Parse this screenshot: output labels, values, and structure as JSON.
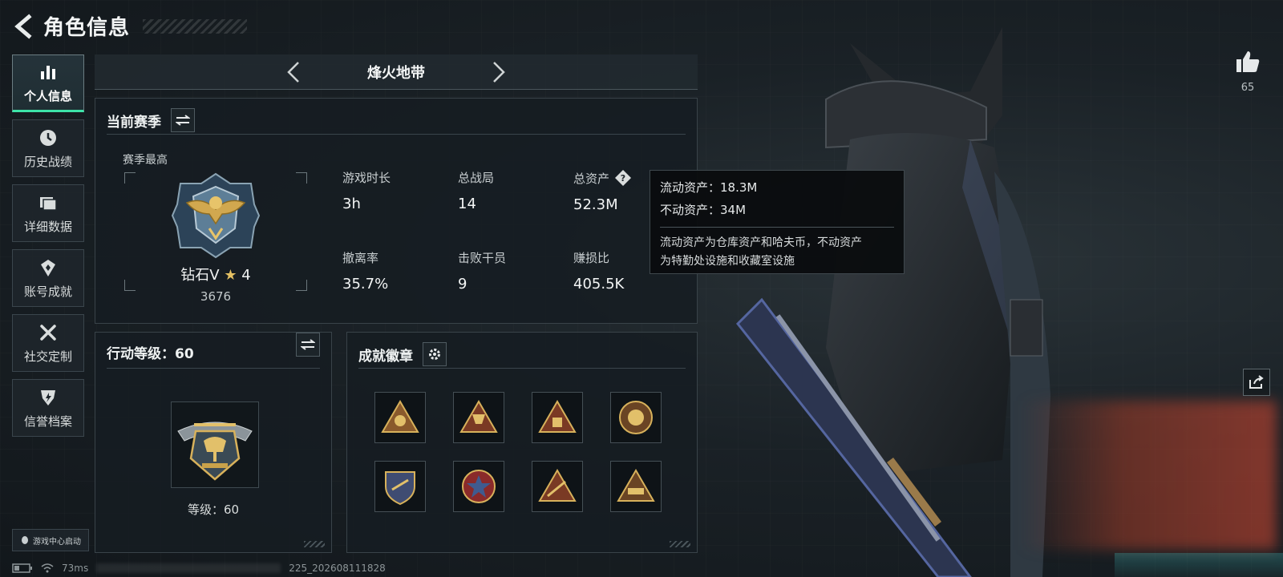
{
  "header": {
    "title": "角色信息"
  },
  "sidebar": {
    "items": [
      {
        "label": "个人信息",
        "icon": "bar-chart-icon",
        "active": true
      },
      {
        "label": "历史战绩",
        "icon": "history-icon",
        "active": false
      },
      {
        "label": "详细数据",
        "icon": "folder-icon",
        "active": false
      },
      {
        "label": "账号成就",
        "icon": "achievement-icon",
        "active": false
      },
      {
        "label": "社交定制",
        "icon": "tools-icon",
        "active": false
      },
      {
        "label": "信誉档案",
        "icon": "credit-icon",
        "active": false
      }
    ],
    "game_center_label": "游戏中心启动"
  },
  "mode": {
    "name": "烽火地带"
  },
  "season": {
    "title": "当前赛季",
    "best_label": "赛季最高",
    "rank_name": "钻石V",
    "rank_stars": "4",
    "rank_score": "3676",
    "stats": {
      "play_time": {
        "label": "游戏时长",
        "value": "3h"
      },
      "total_matches": {
        "label": "总战局",
        "value": "14"
      },
      "total_assets": {
        "label": "总资产",
        "value": "52.3M"
      },
      "extract_rate": {
        "label": "撤离率",
        "value": "35.7%"
      },
      "kills": {
        "label": "击败干员",
        "value": "9"
      },
      "profit_ratio": {
        "label": "赚损比",
        "value": "405.5K"
      }
    }
  },
  "tooltip": {
    "liquid": "流动资产：18.3M",
    "fixed": "不动资产：34M",
    "desc_line1": "流动资产为仓库资产和哈夫币，不动资产",
    "desc_line2": "为特勤处设施和收藏室设施"
  },
  "level": {
    "title": "行动等级：60",
    "caption": "等级：60"
  },
  "badges": {
    "title": "成就徽章"
  },
  "social": {
    "like_count": "65"
  },
  "status": {
    "ping": "73ms",
    "id_suffix": "225_20260811182​8"
  },
  "colors": {
    "accent": "#3de3a8",
    "gold": "#c9a24a",
    "panel_border": "#394349"
  }
}
